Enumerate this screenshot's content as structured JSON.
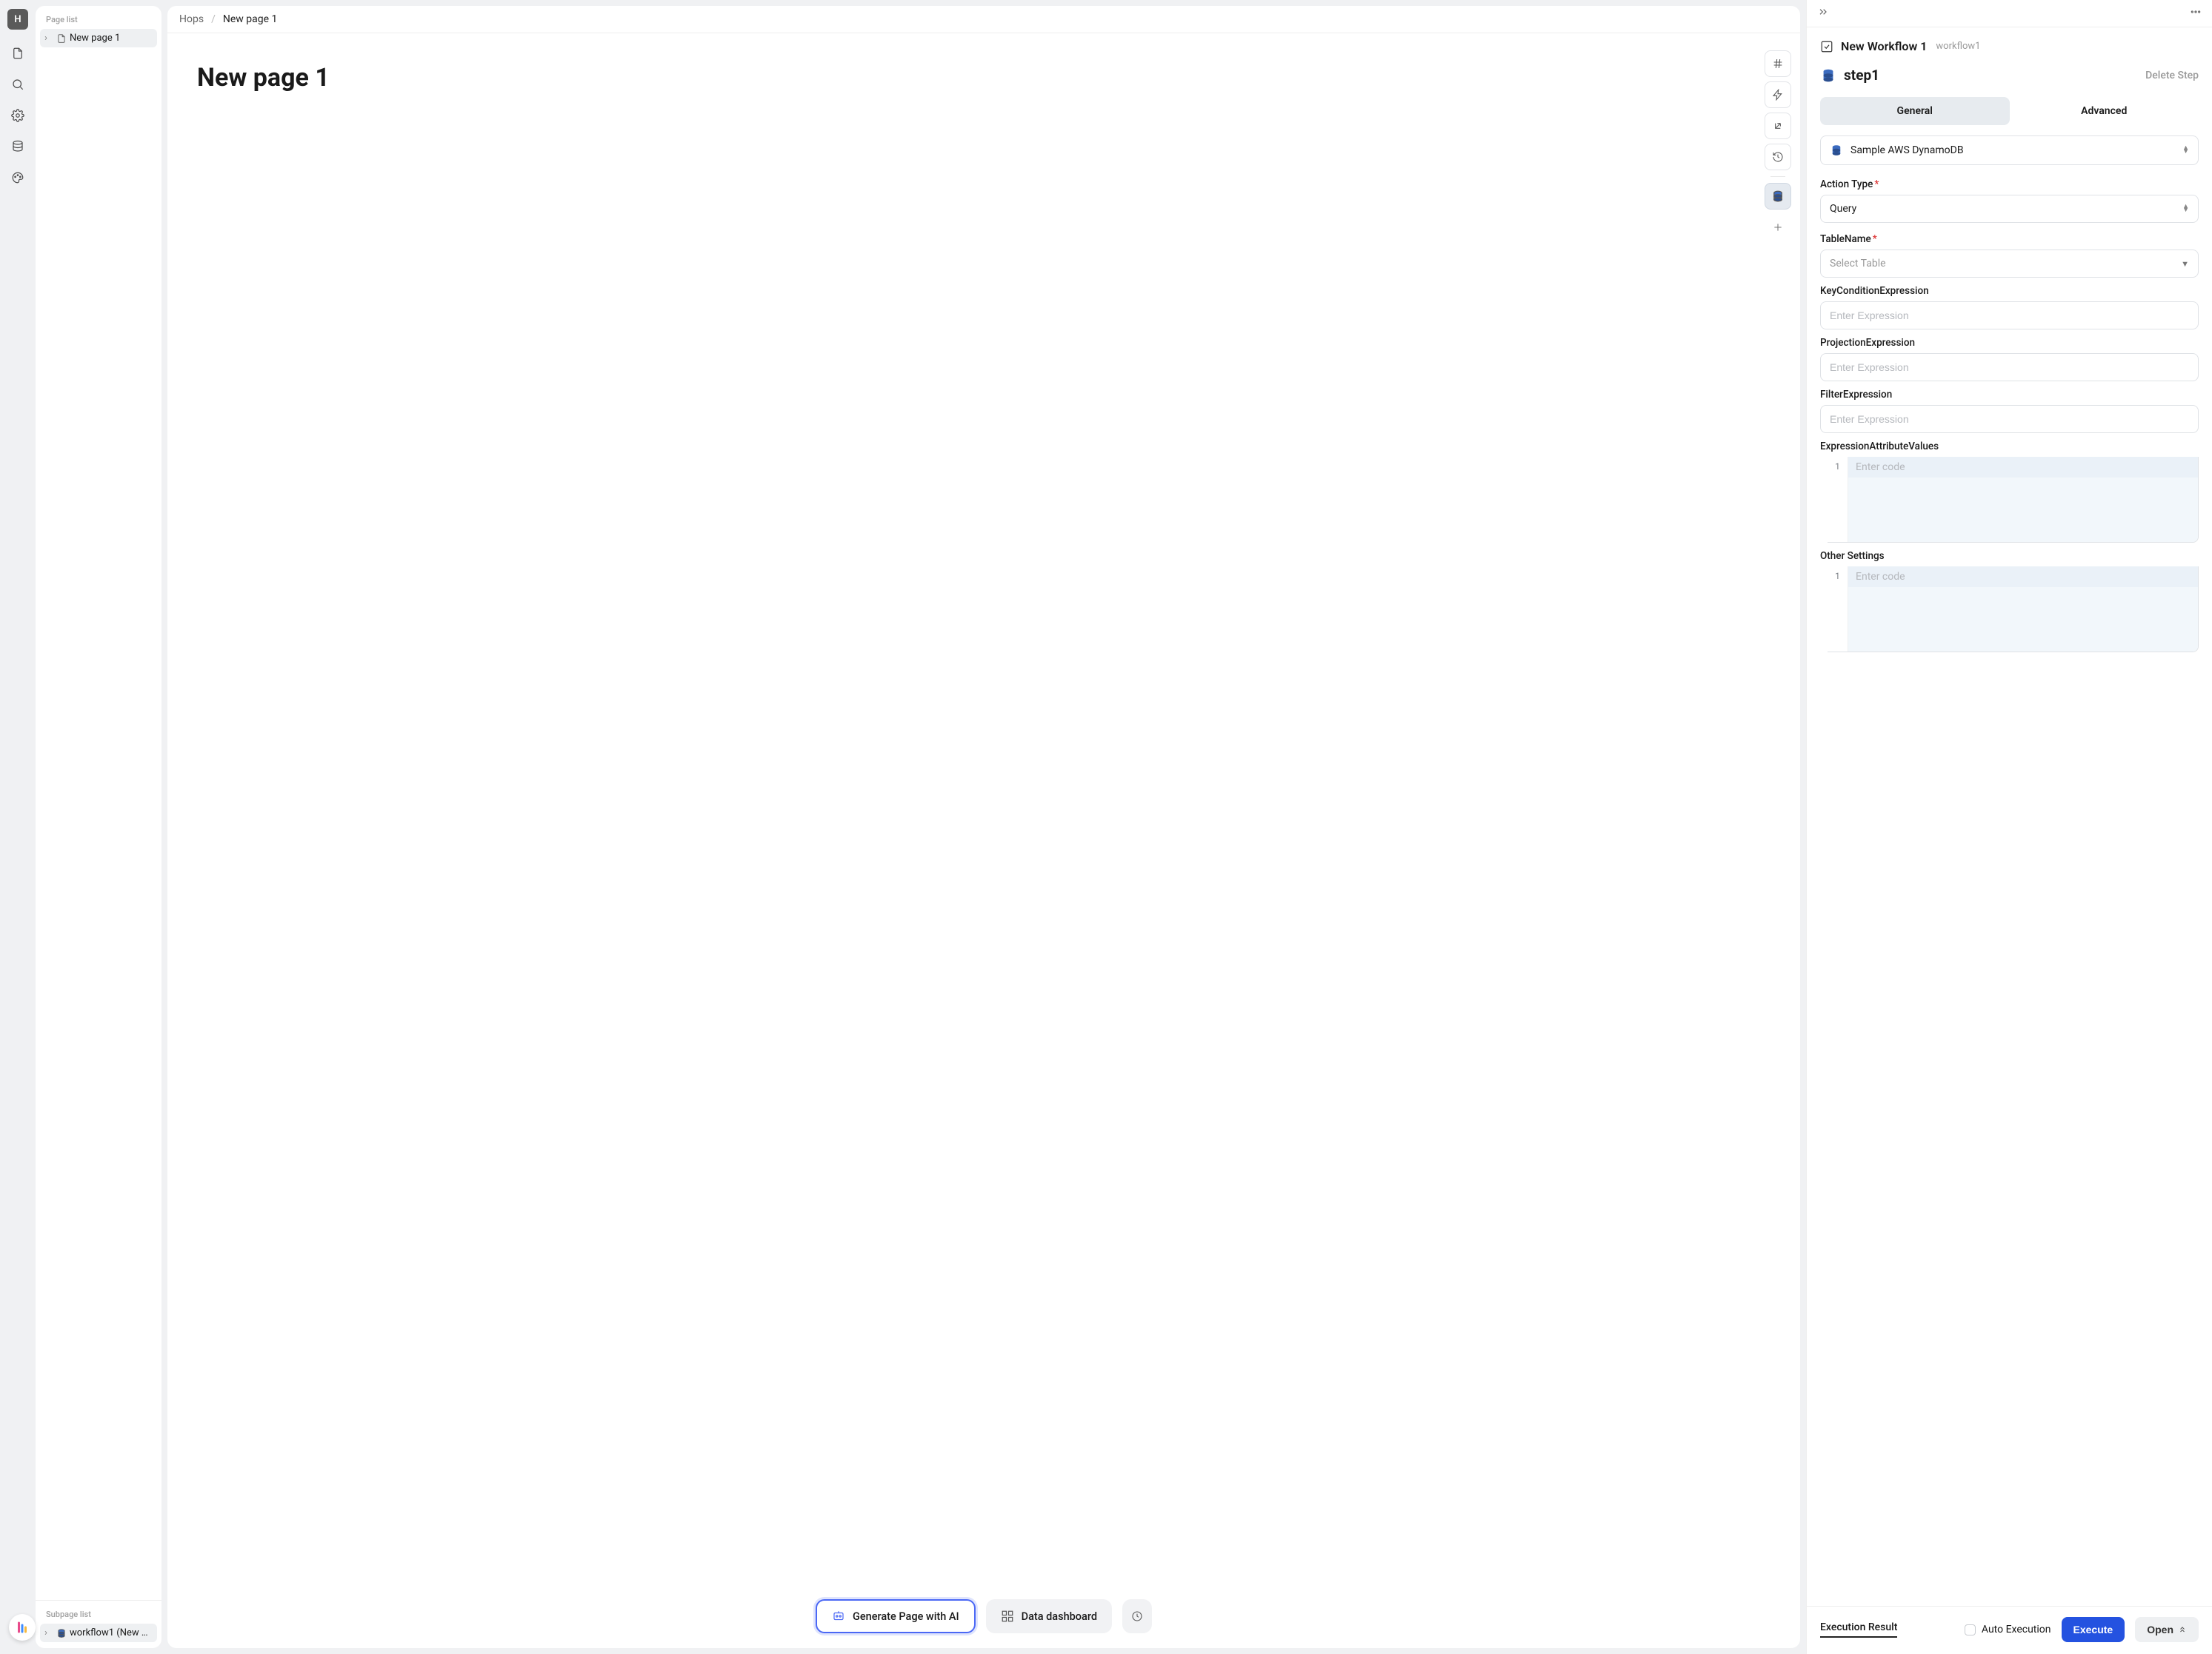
{
  "avatar": "H",
  "page_list_label": "Page list",
  "page_list_item": "New page 1",
  "subpage_list_label": "Subpage list",
  "subpage_item": "workflow1 (New …",
  "breadcrumb": {
    "root": "Hops",
    "current": "New page 1"
  },
  "page_title": "New page 1",
  "bottom": {
    "generate": "Generate Page with AI",
    "dashboard": "Data dashboard"
  },
  "panel": {
    "workflow_title": "New Workflow 1",
    "workflow_id": "workflow1",
    "step_name": "step1",
    "delete_step": "Delete Step",
    "tab_general": "General",
    "tab_advanced": "Advanced",
    "datasource": "Sample AWS DynamoDB",
    "action_type_label": "Action Type",
    "action_type_value": "Query",
    "tablename_label": "TableName",
    "tablename_placeholder": "Select Table",
    "keycond_label": "KeyConditionExpression",
    "proj_label": "ProjectionExpression",
    "filter_label": "FilterExpression",
    "expr_placeholder": "Enter Expression",
    "eav_label": "ExpressionAttributeValues",
    "other_label": "Other Settings",
    "code_placeholder": "Enter code",
    "gutter_1": "1",
    "exec_result": "Execution Result",
    "auto_exec": "Auto Execution",
    "execute": "Execute",
    "open": "Open"
  }
}
